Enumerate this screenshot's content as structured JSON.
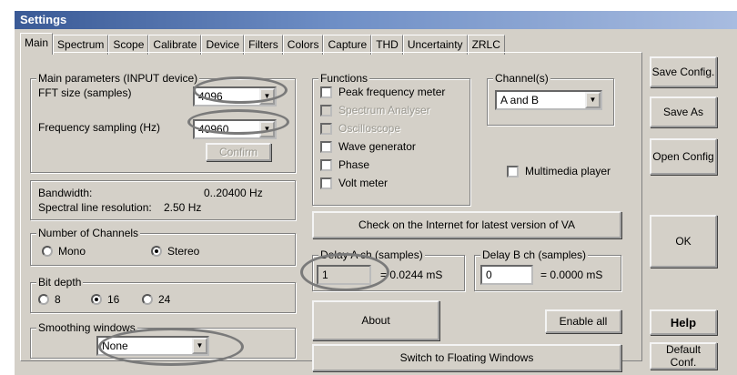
{
  "window": {
    "title": "Settings"
  },
  "tabs": [
    "Main",
    "Spectrum",
    "Scope",
    "Calibrate",
    "Device",
    "Filters",
    "Colors",
    "Capture",
    "THD",
    "Uncertainty",
    "ZRLC"
  ],
  "main_params": {
    "legend": "Main parameters (INPUT device)",
    "fft_label": "FFT size (samples)",
    "fft_value": "4096",
    "fs_label": "Frequency sampling (Hz)",
    "fs_value": "40960",
    "confirm_label": "Confirm"
  },
  "info": {
    "bandwidth_label": "Bandwidth:",
    "bandwidth_value": "0..20400 Hz",
    "resolution_label": "Spectral line resolution:",
    "resolution_value": "2.50 Hz"
  },
  "channels": {
    "legend": "Number of Channels",
    "mono": "Mono",
    "stereo": "Stereo",
    "selected": "Stereo"
  },
  "bitdepth": {
    "legend": "Bit depth",
    "options": [
      "8",
      "16",
      "24"
    ],
    "selected": "16"
  },
  "smoothing": {
    "legend": "Smoothing windows",
    "value": "None"
  },
  "functions": {
    "legend": "Functions",
    "items": [
      {
        "label": "Peak frequency meter",
        "enabled": true
      },
      {
        "label": "Spectrum Analyser",
        "enabled": false
      },
      {
        "label": "Oscilloscope",
        "enabled": false
      },
      {
        "label": "Wave generator",
        "enabled": true
      },
      {
        "label": "Phase",
        "enabled": true
      },
      {
        "label": "Volt meter",
        "enabled": true
      }
    ]
  },
  "channel_select": {
    "legend": "Channel(s)",
    "value": "A and B"
  },
  "multimedia_label": "Multimedia player",
  "check_internet_label": "Check on the Internet for latest version of VA",
  "delay_a": {
    "legend": "Delay A ch (samples)",
    "value": "1",
    "ms": "= 0.0244 mS"
  },
  "delay_b": {
    "legend": "Delay B ch (samples)",
    "value": "0",
    "ms": "= 0.0000 mS"
  },
  "about_label": "About",
  "enable_all_label": "Enable all",
  "switch_label": "Switch to Floating Windows",
  "side_buttons": {
    "save_config": "Save Config.",
    "save_as": "Save As",
    "open_config": "Open Config",
    "ok": "OK",
    "help": "Help",
    "default_conf": "Default Conf."
  }
}
